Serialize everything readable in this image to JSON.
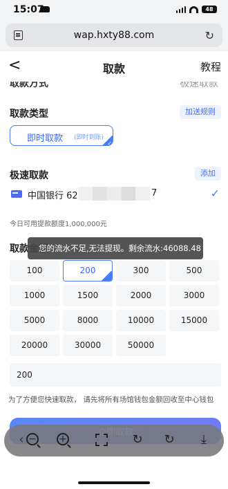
{
  "status_bar": {
    "time": "15:07",
    "battery": "48"
  },
  "browser": {
    "url": "wap.hxty88.com"
  },
  "nav": {
    "back": "<",
    "title": "取款",
    "right": "教程"
  },
  "cut_off": {
    "left": "取款方式",
    "right": "极速取款"
  },
  "withdraw_type": {
    "title": "取款类型",
    "rules_link": "加送规则",
    "selected_main": "即时取款",
    "selected_sub": "(即时到账)"
  },
  "fast_withdraw": {
    "title": "极速取款",
    "add_link": "添加",
    "bank_name": "中国银行",
    "account_prefix": "621",
    "account_suffix": "7",
    "quota_text": "今日可用提款额度1,000,000元"
  },
  "amount_section": {
    "title": "取款金额",
    "options": [
      "100",
      "200",
      "300",
      "500",
      "1000",
      "1500",
      "2000",
      "3000",
      "5000",
      "8000",
      "10000",
      "15000",
      "20000",
      "30000",
      "50000"
    ],
    "selected": "200",
    "input_value": "200"
  },
  "toast": {
    "message": "您的流水不足,无法提现。剩余流水:46088.48"
  },
  "tip": {
    "text": "为了方便您快速取款，  请先将所有场馆钱包金额回收至中心钱包"
  },
  "submit": {
    "label": "立即取款"
  },
  "toolbar": {
    "zoom_out": "−",
    "zoom_in": "+",
    "reload": "↻",
    "download": "⤓"
  },
  "colors": {
    "accent": "#4a7cf7",
    "toast_bg": "#464646"
  }
}
